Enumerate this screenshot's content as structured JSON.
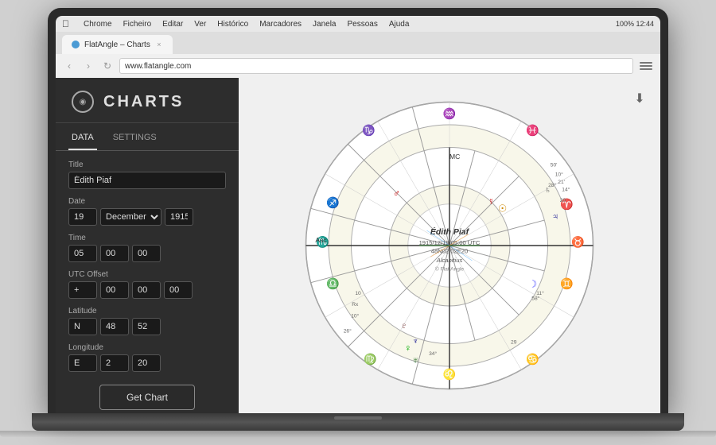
{
  "menubar": {
    "apple": "⌘",
    "items": [
      "Chrome",
      "Ficheiro",
      "Editar",
      "Ver",
      "Histórico",
      "Marcadores",
      "Janela",
      "Pessoas",
      "Ajuda"
    ],
    "rightInfo": "100%  12:44"
  },
  "browser": {
    "tab_label": "FlatAngle – Charts",
    "address": "www.flatangle.com"
  },
  "sidebar": {
    "logo_text": "◉",
    "title": "CHARTS",
    "tab_data": "DATA",
    "tab_settings": "SETTINGS",
    "form": {
      "title_label": "Title",
      "title_value": "Édith Piaf",
      "date_label": "Date",
      "date_day": "19",
      "date_month": "December",
      "date_year": "1915",
      "time_label": "Time",
      "time_h": "05",
      "time_m": "00",
      "time_s": "00",
      "utc_label": "UTC Offset",
      "utc_sign": "+",
      "utc_h": "00",
      "utc_m": "00",
      "utc_s": "00",
      "lat_label": "Latitude",
      "lat_dir": "N",
      "lat_d": "48",
      "lat_m": "52",
      "lon_label": "Longitude",
      "lon_dir": "E",
      "lon_d": "2",
      "lon_m": "20",
      "btn_label": "Get Chart"
    }
  },
  "chart": {
    "person_name": "Édith Piaf",
    "chart_info1": "1915/12/19 05:00 UTC",
    "chart_info2": "48N02 02E20",
    "chart_type": "Alcabitius",
    "copyright": "© Flat Angle"
  },
  "download_icon": "⬇"
}
